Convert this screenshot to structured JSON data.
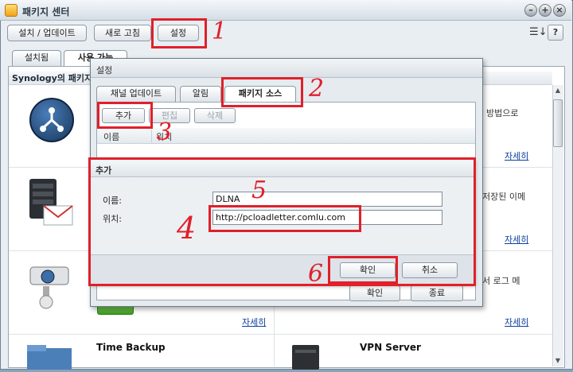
{
  "window": {
    "title": "패키지 센터",
    "controls": [
      "minimize-icon",
      "maximize-icon",
      "close-icon"
    ]
  },
  "toolbar": {
    "install_update": "설치 / 업데이트",
    "refresh": "새로 고침",
    "settings": "설정",
    "help": "?"
  },
  "main_tabs": [
    {
      "label": "설치됨",
      "active": false
    },
    {
      "label": "사용 가능",
      "active": true
    }
  ],
  "section_header": "Synology의 패키지",
  "packages": {
    "row1_right_desc": "방법으로",
    "row2_right_desc": "저장된 이메",
    "row3_right_desc": "서 로그 메",
    "detail_link": "자세히",
    "time_backup": "Time Backup",
    "vpn_server": "VPN Server"
  },
  "settings_dialog": {
    "title": "설정",
    "tabs": [
      {
        "label": "채널 업데이트",
        "active": false
      },
      {
        "label": "알림",
        "active": false
      },
      {
        "label": "패키지 소스",
        "active": true
      }
    ],
    "buttons": {
      "add": "추가",
      "edit": "편집",
      "delete": "삭제"
    },
    "columns": {
      "name": "이름",
      "location": "위치"
    },
    "footer": {
      "ok": "확인",
      "close": "종료"
    }
  },
  "add_dialog": {
    "title": "추가",
    "name_label": "이름:",
    "name_value": "DLNA",
    "location_label": "위치:",
    "location_value": "http://pcloadletter.comlu.com",
    "ok": "확인",
    "cancel": "취소"
  },
  "annotations": {
    "color": "#e0202a",
    "steps": [
      "1",
      "2",
      "3",
      "4",
      "5",
      "6"
    ]
  }
}
